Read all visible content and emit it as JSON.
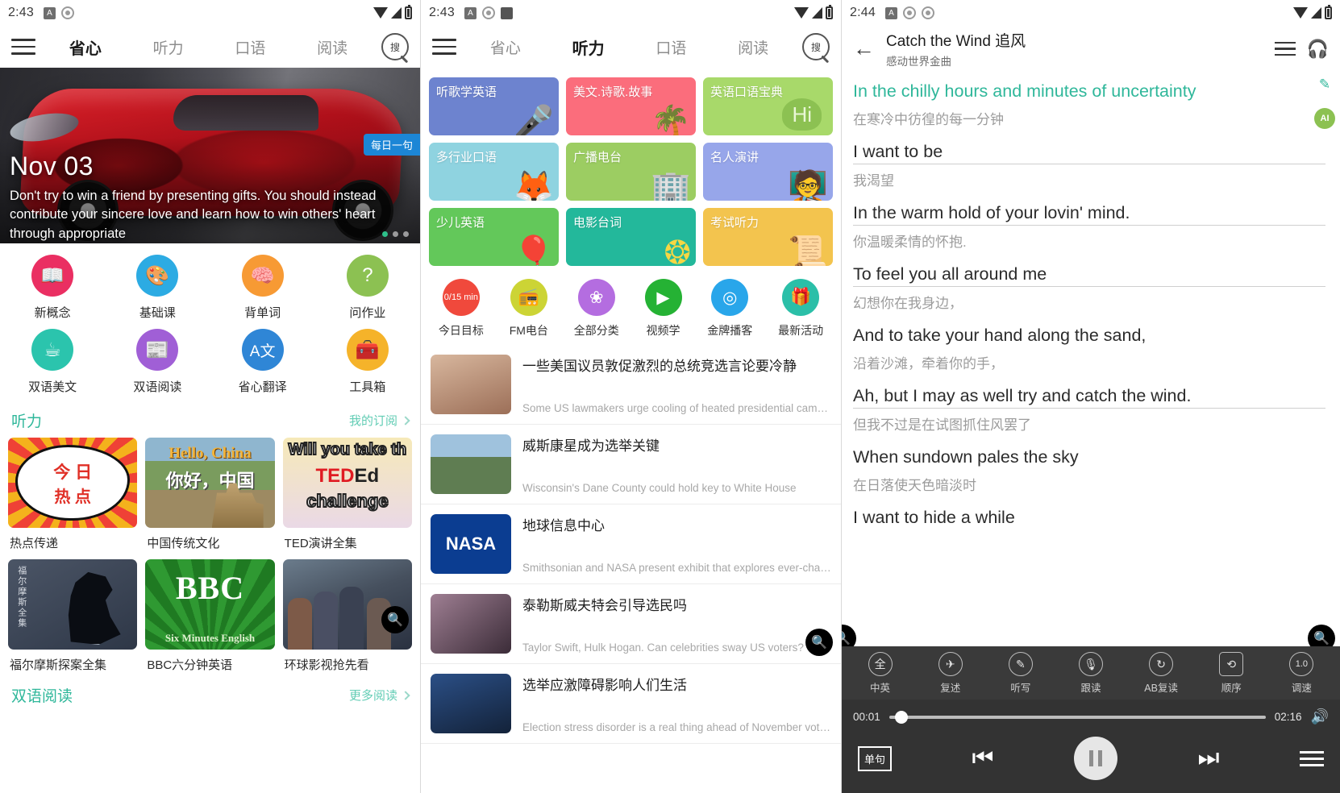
{
  "panel1": {
    "status": {
      "time": "2:43"
    },
    "nav": {
      "tabs": [
        {
          "label": "省心",
          "active": true
        },
        {
          "label": "听力",
          "active": false
        },
        {
          "label": "口语",
          "active": false
        },
        {
          "label": "阅读",
          "active": false
        }
      ],
      "search_label": "搜"
    },
    "hero": {
      "date": "Nov 03",
      "badge": "每日一句",
      "quote": "Don't try to win a friend by presenting gifts. You should instead contribute your sincere love and learn how to win others' heart through appropriate"
    },
    "quick_entries": [
      {
        "label": "新概念",
        "icon": "book-icon",
        "color": "#ea2f62",
        "glyph": "📕"
      },
      {
        "label": "基础课",
        "icon": "palette-icon",
        "color": "#2cabe3",
        "glyph": "🎨"
      },
      {
        "label": "背单词",
        "icon": "brain-icon",
        "color": "#f79a34",
        "glyph": "🧠"
      },
      {
        "label": "问作业",
        "icon": "question-cloud-icon",
        "color": "#8cc152",
        "glyph": "❓"
      },
      {
        "label": "双语美文",
        "icon": "coffee-icon",
        "color": "#2bc4ad",
        "glyph": "☕"
      },
      {
        "label": "双语阅读",
        "icon": "article-icon",
        "color": "#a05fd6",
        "glyph": "📰"
      },
      {
        "label": "省心翻译",
        "icon": "translate-icon",
        "color": "#2f86d6",
        "glyph": "🅰"
      },
      {
        "label": "工具箱",
        "icon": "toolbox-icon",
        "color": "#f5b32a",
        "glyph": "🧰"
      }
    ],
    "section_listening": {
      "title": "听力",
      "more": "我的订阅"
    },
    "listening_cards": [
      {
        "caption": "热点传递",
        "thumb": "hot-today-thumb",
        "line1": "今 日",
        "line2": "热 点"
      },
      {
        "caption": "中国传统文化",
        "thumb": "hello-china-thumb",
        "en": "Hello, China",
        "cn": "你好，中国"
      },
      {
        "caption": "TED演讲全集",
        "thumb": "ted-ed-thumb",
        "w1": "Will you take th",
        "w2a": "TED",
        "w2b": "Ed",
        "w3": "challenge"
      },
      {
        "caption": "福尔摩斯探案全集",
        "thumb": "holmes-thumb",
        "vtext": "福尔摩斯全集"
      },
      {
        "caption": "BBC六分钟英语",
        "thumb": "bbc-thumb",
        "big": "BBC",
        "small": "Six Minutes English"
      },
      {
        "caption": "环球影视抢先看",
        "thumb": "movie-thumb"
      }
    ],
    "section_reading": {
      "title": "双语阅读",
      "more": "更多阅读"
    },
    "zoom_badge": "zoom-icon"
  },
  "panel2": {
    "status": {
      "time": "2:43"
    },
    "nav": {
      "tabs": [
        {
          "label": "省心",
          "active": false
        },
        {
          "label": "听力",
          "active": true
        },
        {
          "label": "口语",
          "active": false
        },
        {
          "label": "阅读",
          "active": false
        }
      ],
      "search_label": "搜"
    },
    "tiles": [
      {
        "label": "听歌学英语",
        "color": "#6d83cf",
        "art": "🎤"
      },
      {
        "label": "美文.诗歌.故事",
        "color": "#fb6d7c",
        "art": "🌴"
      },
      {
        "label": "英语口语宝典",
        "color": "#a8d96a",
        "art": "Hi"
      },
      {
        "label": "多行业口语",
        "color": "#8fd3e0",
        "art": "🦊"
      },
      {
        "label": "广播电台",
        "color": "#9ccd62",
        "art": "🏢"
      },
      {
        "label": "名人演讲",
        "color": "#97a6ea",
        "art": "👨‍🏫"
      },
      {
        "label": "少儿英语",
        "color": "#63c85a",
        "art": "🎈"
      },
      {
        "label": "电影台词",
        "color": "#23b89b",
        "art": "🎞"
      },
      {
        "label": "考试听力",
        "color": "#f3c košice",
        "art": "📜"
      }
    ],
    "quick_row": [
      {
        "label": "今日目标",
        "icon": "daily-goal-icon",
        "color": "#f0493c",
        "text": "0/15 min"
      },
      {
        "label": "FM电台",
        "icon": "radio-icon",
        "color": "#ccd435",
        "glyph": "📻"
      },
      {
        "label": "全部分类",
        "icon": "categories-icon",
        "color": "#b46de0",
        "glyph": "❀"
      },
      {
        "label": "视频学",
        "icon": "video-icon",
        "color": "#25b234",
        "glyph": "📺"
      },
      {
        "label": "金牌播客",
        "icon": "podcast-icon",
        "color": "#29a6ea",
        "glyph": "((·))"
      },
      {
        "label": "最新活动",
        "icon": "gift-icon",
        "color": "#2bbfa8",
        "glyph": "🎁"
      }
    ],
    "news": [
      {
        "title": "一些美国议员敦促激烈的总统竞选言论要冷静",
        "desc": "Some US lawmakers urge cooling of heated presidential campai…",
        "thumb": "trump-thumb"
      },
      {
        "title": "威斯康星成为选举关键",
        "desc": "Wisconsin's Dane County could hold key to White House",
        "thumb": "wisconsin-thumb"
      },
      {
        "title": "地球信息中心",
        "desc": "Smithsonian and NASA present exhibit that explores ever-changi…",
        "thumb": "nasa-thumb"
      },
      {
        "title": "泰勒斯威夫特会引导选民吗",
        "desc": "Taylor Swift, Hulk Hogan. Can celebrities sway US voters?",
        "thumb": "taylor-thumb"
      },
      {
        "title": "选举应激障碍影响人们生活",
        "desc": "Election stress disorder is a real thing ahead of November voting",
        "thumb": "election-thumb"
      }
    ],
    "zoom_badge": "zoom-icon"
  },
  "panel3": {
    "status": {
      "time": "2:44"
    },
    "header": {
      "back": "←",
      "title": "Catch the Wind 追风",
      "subtitle": "感动世界金曲",
      "list_icon": "playlist-icon",
      "headphone_icon": "headphone-icon"
    },
    "side_tools": [
      {
        "icon": "highlighter-icon",
        "glyph": "✎"
      },
      {
        "icon": "ai-lightbulb-icon",
        "glyph": "AI"
      }
    ],
    "lyrics": [
      {
        "en": "In the chilly hours and minutes of uncertainty",
        "cn": "在寒冷中彷徨的每一分钟",
        "current": true
      },
      {
        "en": "I want to be",
        "cn": "我渴望",
        "current": false
      },
      {
        "en": "In the warm hold of your lovin' mind.",
        "cn": "你温暖柔情的怀抱.",
        "current": false
      },
      {
        "en": "To feel you all around me",
        "cn": "幻想你在我身边，",
        "current": false
      },
      {
        "en": "And to take your hand along the sand,",
        "cn": "沿着沙滩，牵着你的手，",
        "current": false
      },
      {
        "en": "Ah, but I may as well try and catch the wind.",
        "cn": "但我不过是在试图抓住风罢了",
        "current": false
      },
      {
        "en": "When sundown pales the sky",
        "cn": "在日落使天色暗淡时",
        "current": false
      },
      {
        "en": "I want to hide a while",
        "cn": "",
        "current": false
      }
    ],
    "tools": [
      {
        "label": "中英",
        "icon": "bilingual-icon",
        "glyph": "全"
      },
      {
        "label": "复述",
        "icon": "retell-icon",
        "glyph": "✈"
      },
      {
        "label": "听写",
        "icon": "dictation-icon",
        "glyph": "✎"
      },
      {
        "label": "跟读",
        "icon": "follow-read-icon",
        "glyph": "🎙"
      },
      {
        "label": "AB复读",
        "icon": "ab-repeat-icon",
        "glyph": "↻"
      },
      {
        "label": "顺序",
        "icon": "order-icon",
        "glyph": "⟲"
      },
      {
        "label": "调速",
        "icon": "speed-icon",
        "glyph": "1.0"
      }
    ],
    "player": {
      "current_time": "00:01",
      "total_time": "02:16",
      "progress_percent": 1,
      "repeat_label": "单句",
      "prev_icon": "previous-icon",
      "play_icon": "pause-icon",
      "next_icon": "next-icon",
      "menu_icon": "menu-icon",
      "volume_icon": "volume-icon"
    },
    "zoom_badge": "zoom-icon"
  }
}
